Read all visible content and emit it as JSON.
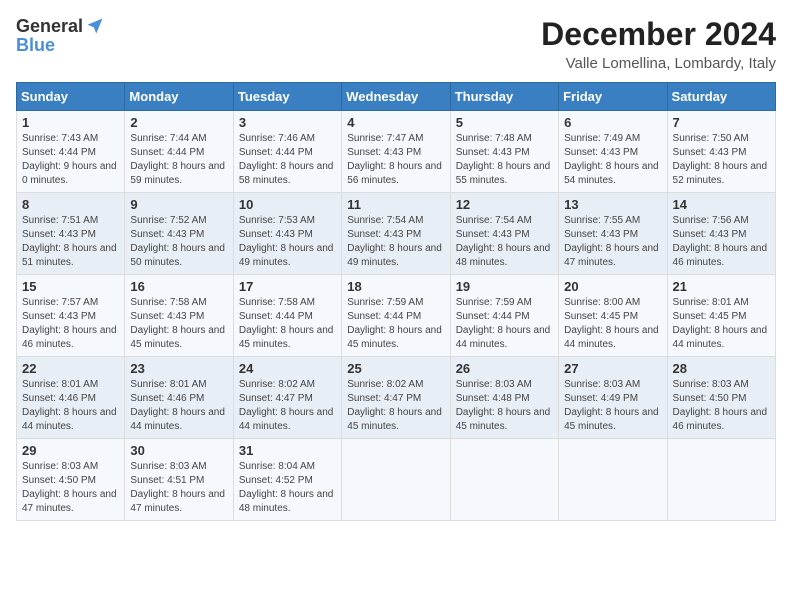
{
  "header": {
    "logo_general": "General",
    "logo_blue": "Blue",
    "month_title": "December 2024",
    "location": "Valle Lomellina, Lombardy, Italy"
  },
  "days_of_week": [
    "Sunday",
    "Monday",
    "Tuesday",
    "Wednesday",
    "Thursday",
    "Friday",
    "Saturday"
  ],
  "weeks": [
    [
      {
        "day": "1",
        "sunrise": "Sunrise: 7:43 AM",
        "sunset": "Sunset: 4:44 PM",
        "daylight": "Daylight: 9 hours and 0 minutes."
      },
      {
        "day": "2",
        "sunrise": "Sunrise: 7:44 AM",
        "sunset": "Sunset: 4:44 PM",
        "daylight": "Daylight: 8 hours and 59 minutes."
      },
      {
        "day": "3",
        "sunrise": "Sunrise: 7:46 AM",
        "sunset": "Sunset: 4:44 PM",
        "daylight": "Daylight: 8 hours and 58 minutes."
      },
      {
        "day": "4",
        "sunrise": "Sunrise: 7:47 AM",
        "sunset": "Sunset: 4:43 PM",
        "daylight": "Daylight: 8 hours and 56 minutes."
      },
      {
        "day": "5",
        "sunrise": "Sunrise: 7:48 AM",
        "sunset": "Sunset: 4:43 PM",
        "daylight": "Daylight: 8 hours and 55 minutes."
      },
      {
        "day": "6",
        "sunrise": "Sunrise: 7:49 AM",
        "sunset": "Sunset: 4:43 PM",
        "daylight": "Daylight: 8 hours and 54 minutes."
      },
      {
        "day": "7",
        "sunrise": "Sunrise: 7:50 AM",
        "sunset": "Sunset: 4:43 PM",
        "daylight": "Daylight: 8 hours and 52 minutes."
      }
    ],
    [
      {
        "day": "8",
        "sunrise": "Sunrise: 7:51 AM",
        "sunset": "Sunset: 4:43 PM",
        "daylight": "Daylight: 8 hours and 51 minutes."
      },
      {
        "day": "9",
        "sunrise": "Sunrise: 7:52 AM",
        "sunset": "Sunset: 4:43 PM",
        "daylight": "Daylight: 8 hours and 50 minutes."
      },
      {
        "day": "10",
        "sunrise": "Sunrise: 7:53 AM",
        "sunset": "Sunset: 4:43 PM",
        "daylight": "Daylight: 8 hours and 49 minutes."
      },
      {
        "day": "11",
        "sunrise": "Sunrise: 7:54 AM",
        "sunset": "Sunset: 4:43 PM",
        "daylight": "Daylight: 8 hours and 49 minutes."
      },
      {
        "day": "12",
        "sunrise": "Sunrise: 7:54 AM",
        "sunset": "Sunset: 4:43 PM",
        "daylight": "Daylight: 8 hours and 48 minutes."
      },
      {
        "day": "13",
        "sunrise": "Sunrise: 7:55 AM",
        "sunset": "Sunset: 4:43 PM",
        "daylight": "Daylight: 8 hours and 47 minutes."
      },
      {
        "day": "14",
        "sunrise": "Sunrise: 7:56 AM",
        "sunset": "Sunset: 4:43 PM",
        "daylight": "Daylight: 8 hours and 46 minutes."
      }
    ],
    [
      {
        "day": "15",
        "sunrise": "Sunrise: 7:57 AM",
        "sunset": "Sunset: 4:43 PM",
        "daylight": "Daylight: 8 hours and 46 minutes."
      },
      {
        "day": "16",
        "sunrise": "Sunrise: 7:58 AM",
        "sunset": "Sunset: 4:43 PM",
        "daylight": "Daylight: 8 hours and 45 minutes."
      },
      {
        "day": "17",
        "sunrise": "Sunrise: 7:58 AM",
        "sunset": "Sunset: 4:44 PM",
        "daylight": "Daylight: 8 hours and 45 minutes."
      },
      {
        "day": "18",
        "sunrise": "Sunrise: 7:59 AM",
        "sunset": "Sunset: 4:44 PM",
        "daylight": "Daylight: 8 hours and 45 minutes."
      },
      {
        "day": "19",
        "sunrise": "Sunrise: 7:59 AM",
        "sunset": "Sunset: 4:44 PM",
        "daylight": "Daylight: 8 hours and 44 minutes."
      },
      {
        "day": "20",
        "sunrise": "Sunrise: 8:00 AM",
        "sunset": "Sunset: 4:45 PM",
        "daylight": "Daylight: 8 hours and 44 minutes."
      },
      {
        "day": "21",
        "sunrise": "Sunrise: 8:01 AM",
        "sunset": "Sunset: 4:45 PM",
        "daylight": "Daylight: 8 hours and 44 minutes."
      }
    ],
    [
      {
        "day": "22",
        "sunrise": "Sunrise: 8:01 AM",
        "sunset": "Sunset: 4:46 PM",
        "daylight": "Daylight: 8 hours and 44 minutes."
      },
      {
        "day": "23",
        "sunrise": "Sunrise: 8:01 AM",
        "sunset": "Sunset: 4:46 PM",
        "daylight": "Daylight: 8 hours and 44 minutes."
      },
      {
        "day": "24",
        "sunrise": "Sunrise: 8:02 AM",
        "sunset": "Sunset: 4:47 PM",
        "daylight": "Daylight: 8 hours and 44 minutes."
      },
      {
        "day": "25",
        "sunrise": "Sunrise: 8:02 AM",
        "sunset": "Sunset: 4:47 PM",
        "daylight": "Daylight: 8 hours and 45 minutes."
      },
      {
        "day": "26",
        "sunrise": "Sunrise: 8:03 AM",
        "sunset": "Sunset: 4:48 PM",
        "daylight": "Daylight: 8 hours and 45 minutes."
      },
      {
        "day": "27",
        "sunrise": "Sunrise: 8:03 AM",
        "sunset": "Sunset: 4:49 PM",
        "daylight": "Daylight: 8 hours and 45 minutes."
      },
      {
        "day": "28",
        "sunrise": "Sunrise: 8:03 AM",
        "sunset": "Sunset: 4:50 PM",
        "daylight": "Daylight: 8 hours and 46 minutes."
      }
    ],
    [
      {
        "day": "29",
        "sunrise": "Sunrise: 8:03 AM",
        "sunset": "Sunset: 4:50 PM",
        "daylight": "Daylight: 8 hours and 47 minutes."
      },
      {
        "day": "30",
        "sunrise": "Sunrise: 8:03 AM",
        "sunset": "Sunset: 4:51 PM",
        "daylight": "Daylight: 8 hours and 47 minutes."
      },
      {
        "day": "31",
        "sunrise": "Sunrise: 8:04 AM",
        "sunset": "Sunset: 4:52 PM",
        "daylight": "Daylight: 8 hours and 48 minutes."
      },
      null,
      null,
      null,
      null
    ]
  ]
}
